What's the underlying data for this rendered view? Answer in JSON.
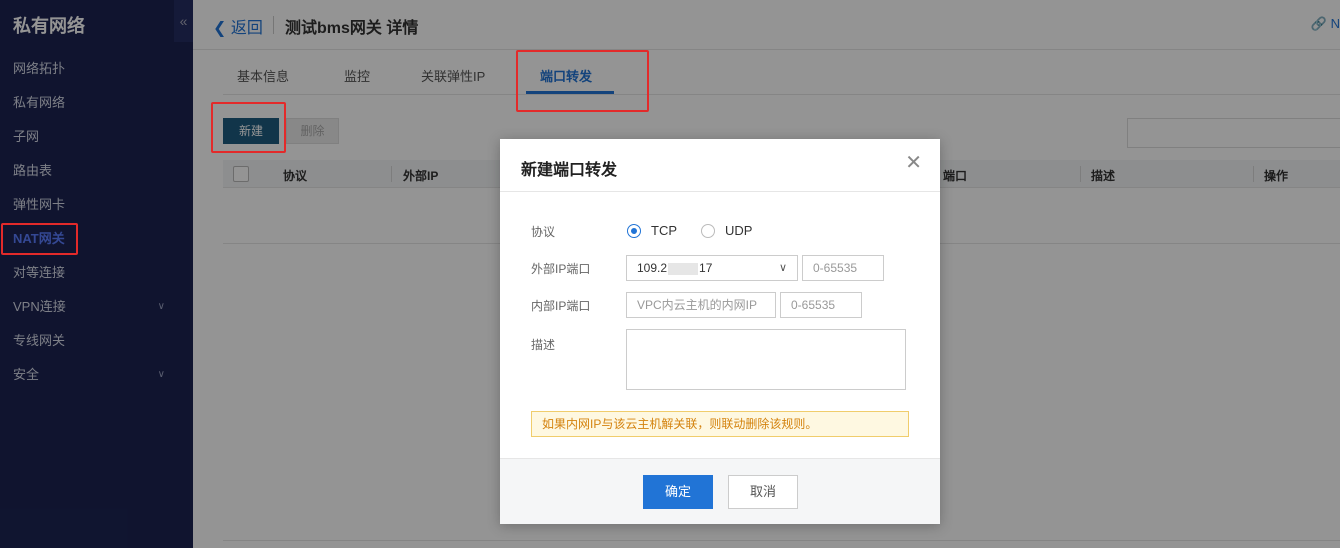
{
  "sidebar": {
    "title": "私有网络",
    "collapse_icon": "«",
    "items": [
      {
        "label": "网络拓扑"
      },
      {
        "label": "私有网络"
      },
      {
        "label": "子网"
      },
      {
        "label": "路由表"
      },
      {
        "label": "弹性网卡"
      },
      {
        "label": "NAT网关",
        "active": true
      },
      {
        "label": "对等连接"
      },
      {
        "label": "VPN连接",
        "expandable": true
      },
      {
        "label": "专线网关"
      },
      {
        "label": "安全",
        "expandable": true
      }
    ]
  },
  "header": {
    "back_label": "返回",
    "title": "测试bms网关 详情",
    "top_link": "N"
  },
  "tabs": [
    {
      "label": "基本信息"
    },
    {
      "label": "监控"
    },
    {
      "label": "关联弹性IP"
    },
    {
      "label": "端口转发",
      "active": true
    }
  ],
  "toolbar": {
    "new_label": "新建",
    "delete_label": "删除"
  },
  "table": {
    "columns": [
      "协议",
      "外部IP",
      "端口",
      "描述",
      "操作"
    ]
  },
  "modal": {
    "title": "新建端口转发",
    "protocol_label": "协议",
    "protocol_options": [
      "TCP",
      "UDP"
    ],
    "protocol_selected": "TCP",
    "external_label": "外部IP端口",
    "external_ip_prefix": "109.2",
    "external_ip_suffix": "17",
    "external_port_placeholder": "0-65535",
    "internal_label": "内部IP端口",
    "internal_ip_placeholder": "VPC内云主机的内网IP",
    "internal_port_placeholder": "0-65535",
    "desc_label": "描述",
    "warning": "如果内网IP与该云主机解关联，则联动删除该规则。",
    "ok_label": "确定",
    "cancel_label": "取消"
  },
  "colors": {
    "sidebar_bg": "#1c2452",
    "primary": "#2174d6",
    "highlight": "#e32a2a"
  }
}
